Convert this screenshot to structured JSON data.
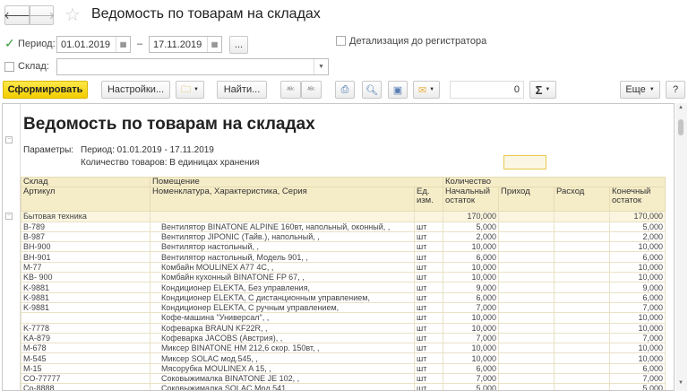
{
  "window": {
    "title": "Ведомость по товарам на складах"
  },
  "filters": {
    "period_label": "Период:",
    "period_checked": true,
    "date_from": "01.01.2019",
    "date_to": "17.11.2019",
    "dash": "–",
    "more_label": "...",
    "detail_label": "Детализация до регистратора",
    "detail_checked": false,
    "warehouse_label": "Склад:",
    "warehouse_checked": false,
    "warehouse_value": ""
  },
  "toolbar": {
    "generate": "Сформировать",
    "settings": "Настройки...",
    "find": "Найти...",
    "counter": "0",
    "sigma": "Σ",
    "more": "Еще",
    "help": "?"
  },
  "report": {
    "title": "Ведомость по товарам на складах",
    "params_label": "Параметры:",
    "param1": "Период: 01.01.2019 - 17.11.2019",
    "param2": "Количество товаров: В единицах хранения"
  },
  "table": {
    "headers": {
      "warehouse": "Склад",
      "room": "Помещение",
      "quantity": "Количество",
      "article": "Артикул",
      "nomenclature": "Номенклатура, Характеристика, Серия",
      "unit": "Ед. изм.",
      "start": "Начальный остаток",
      "in": "Приход",
      "out": "Расход",
      "end": "Конечный остаток"
    },
    "group": {
      "name": "Бытовая техника",
      "start": "170,000",
      "end": "170,000"
    },
    "rows": [
      [
        "B-789",
        "Вентилятор BINATONE ALPINE 160вт, напольный, оконный, ,",
        "шт",
        "5,000",
        "",
        "",
        "5,000"
      ],
      [
        "B-987",
        "Вентилятор JIPONIC (Тайв.), напольный, ,",
        "шт",
        "2,000",
        "",
        "",
        "2,000"
      ],
      [
        "BH-900",
        "Вентилятор настольный, ,",
        "шт",
        "10,000",
        "",
        "",
        "10,000"
      ],
      [
        "BH-901",
        "Вентилятор настольный, Модель 901, ,",
        "шт",
        "6,000",
        "",
        "",
        "6,000"
      ],
      [
        "M-77",
        "Комбайн MOULINEX  A77 4C, ,",
        "шт",
        "10,000",
        "",
        "",
        "10,000"
      ],
      [
        "KB- 900",
        "Комбайн кухонный BINATONE FP 67, ,",
        "шт",
        "10,000",
        "",
        "",
        "10,000"
      ],
      [
        "K-9881",
        "Кондиционер ELEKTA, Без управления,",
        "шт",
        "9,000",
        "",
        "",
        "9,000"
      ],
      [
        "K-9881",
        "Кондиционер ELEKTA, С дистанционным управлением,",
        "шт",
        "6,000",
        "",
        "",
        "6,000"
      ],
      [
        "K-9881",
        "Кондиционер ELEKTA, С ручным управлением,",
        "шт",
        "7,000",
        "",
        "",
        "7,000"
      ],
      [
        "",
        "Кофе-машина \"Универсал\", ,",
        "шт",
        "10,000",
        "",
        "",
        "10,000"
      ],
      [
        "K-7778",
        "Кофеварка BRAUN KF22R, ,",
        "шт",
        "10,000",
        "",
        "",
        "10,000"
      ],
      [
        "KA-879",
        "Кофеварка JACOBS (Австрия), ,",
        "шт",
        "7,000",
        "",
        "",
        "7,000"
      ],
      [
        "M-678",
        "Миксер BINATONE HM 212,6 скор. 150вт, ,",
        "шт",
        "10,000",
        "",
        "",
        "10,000"
      ],
      [
        "M-545",
        "Миксер SOLAC мод.545, ,",
        "шт",
        "10,000",
        "",
        "",
        "10,000"
      ],
      [
        "M-15",
        "Мясорубка MOULINEX  A 15, ,",
        "шт",
        "6,000",
        "",
        "",
        "6,000"
      ],
      [
        "CO-77777",
        "Соковыжималка  BINATONE JE 102, ,",
        "шт",
        "7,000",
        "",
        "",
        "7,000"
      ],
      [
        "Co-8888",
        "Соковыжималка  SOLAC  Мод.541, ,",
        "шт",
        "5,000",
        "",
        "",
        "5,000"
      ]
    ]
  }
}
